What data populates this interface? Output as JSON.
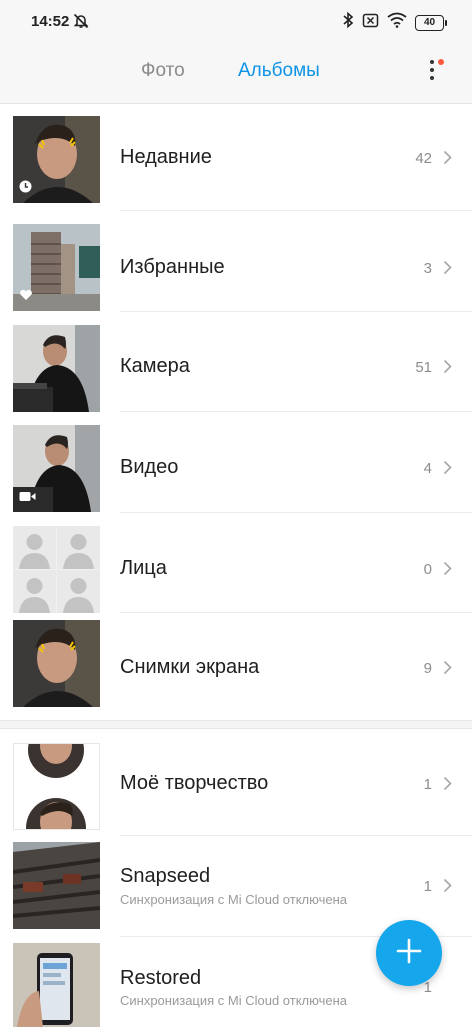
{
  "status": {
    "time": "14:52",
    "battery": "40"
  },
  "tabs": {
    "photo": "Фото",
    "albums": "Альбомы"
  },
  "albums": [
    {
      "title": "Недавние",
      "count": "42"
    },
    {
      "title": "Избранные",
      "count": "3"
    },
    {
      "title": "Камера",
      "count": "51"
    },
    {
      "title": "Видео",
      "count": "4"
    },
    {
      "title": "Лица",
      "count": "0"
    },
    {
      "title": "Снимки экрана",
      "count": "9"
    }
  ],
  "other_albums": [
    {
      "title": "Моё творчество",
      "count": "1"
    },
    {
      "title": "Snapseed",
      "subtitle": "Синхронизация с Mi Cloud отключена",
      "count": "1"
    },
    {
      "title": "Restored",
      "subtitle": "Синхронизация с Mi Cloud отключена",
      "count": "1"
    }
  ],
  "colors": {
    "accent": "#0d93e7",
    "fab": "#15a6ec",
    "notification_dot": "#ff5a3c"
  }
}
